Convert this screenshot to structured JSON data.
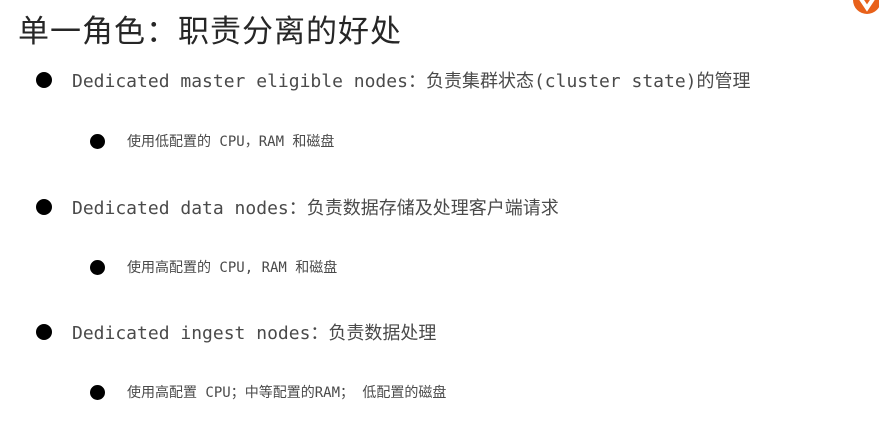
{
  "slide": {
    "title": "单一角色：职责分离的好处",
    "items": [
      {
        "text": "Dedicated master eligible nodes：负责集群状态(cluster state)的管理",
        "sub": "使用低配置的 CPU，RAM 和磁盘"
      },
      {
        "text": "Dedicated data nodes：负责数据存储及处理客户端请求",
        "sub": "使用高配置的 CPU, RAM 和磁盘"
      },
      {
        "text": "Dedicated ingest nodes：负责数据处理",
        "sub": "使用高配置 CPU；中等配置的RAM； 低配置的磁盘"
      }
    ]
  },
  "logo": {
    "icon": "brand-logo-icon",
    "color": "#e8611a"
  }
}
